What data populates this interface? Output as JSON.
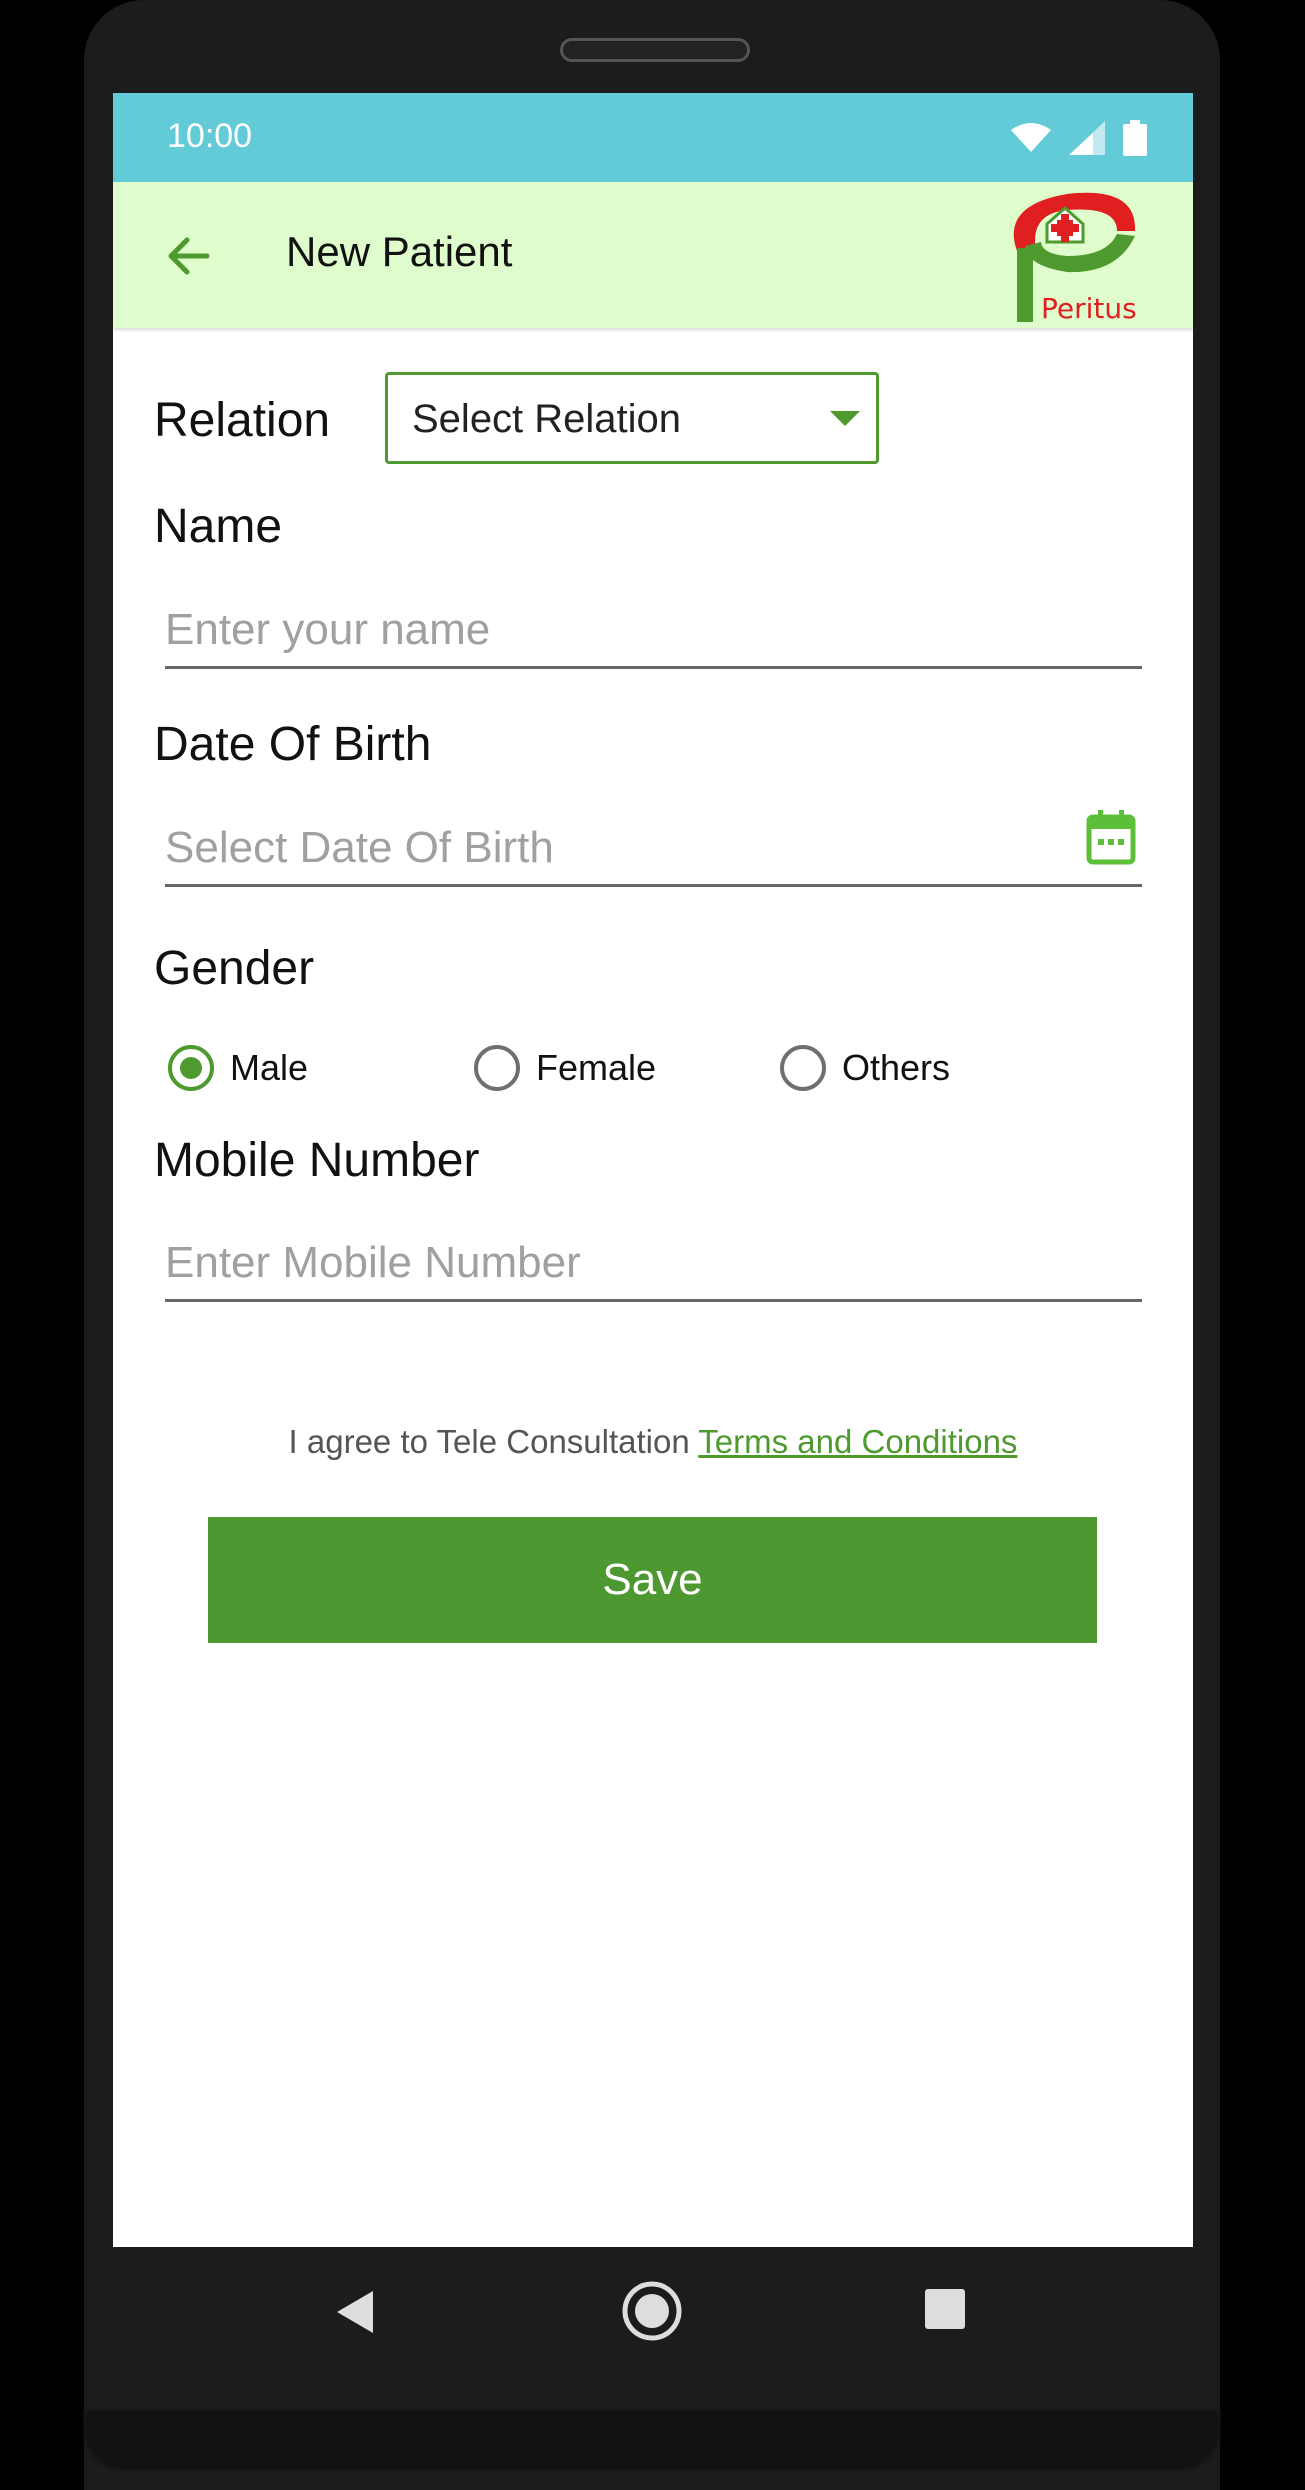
{
  "status_bar": {
    "time": "10:00"
  },
  "app_bar": {
    "title": "New Patient",
    "logo_text": "Peritus"
  },
  "form": {
    "relation": {
      "label": "Relation",
      "selected": "Select Relation"
    },
    "name": {
      "label": "Name",
      "placeholder": "Enter your name"
    },
    "dob": {
      "label": "Date Of Birth",
      "placeholder": "Select Date Of Birth"
    },
    "gender": {
      "label": "Gender",
      "options": [
        {
          "label": "Male",
          "checked": true
        },
        {
          "label": "Female",
          "checked": false
        },
        {
          "label": "Others",
          "checked": false
        }
      ]
    },
    "mobile": {
      "label": "Mobile Number",
      "placeholder": "Enter Mobile Number"
    }
  },
  "terms": {
    "prefix": "I agree to Tele Consultation",
    "link": "Terms and Conditions"
  },
  "save_label": "Save",
  "colors": {
    "accent": "#4e9a2f",
    "status_bar": "#62cbd7",
    "app_bar": "#dffccc",
    "logo_red": "#e02020"
  }
}
